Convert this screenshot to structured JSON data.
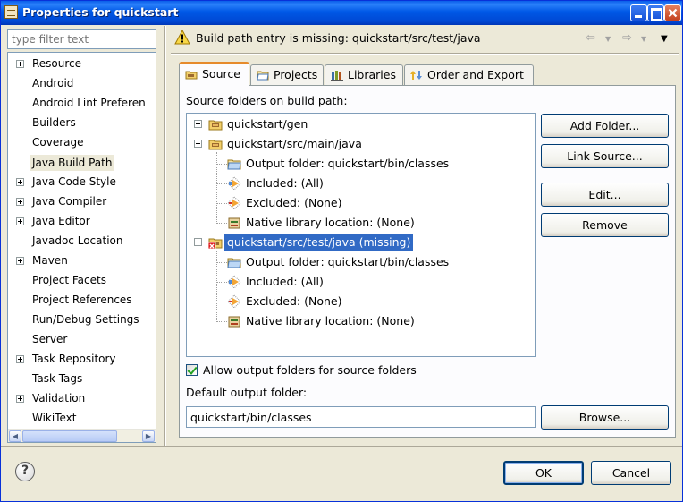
{
  "window": {
    "title": "Properties for quickstart"
  },
  "filter": {
    "placeholder": "type filter text"
  },
  "nav": {
    "items": [
      {
        "label": "Resource",
        "expandable": true
      },
      {
        "label": "Android",
        "expandable": false
      },
      {
        "label": "Android Lint Preferen",
        "expandable": false
      },
      {
        "label": "Builders",
        "expandable": false
      },
      {
        "label": "Coverage",
        "expandable": false
      },
      {
        "label": "Java Build Path",
        "expandable": false,
        "selected": true
      },
      {
        "label": "Java Code Style",
        "expandable": true
      },
      {
        "label": "Java Compiler",
        "expandable": true
      },
      {
        "label": "Java Editor",
        "expandable": true
      },
      {
        "label": "Javadoc Location",
        "expandable": false
      },
      {
        "label": "Maven",
        "expandable": true
      },
      {
        "label": "Project Facets",
        "expandable": false
      },
      {
        "label": "Project References",
        "expandable": false
      },
      {
        "label": "Run/Debug Settings",
        "expandable": false
      },
      {
        "label": "Server",
        "expandable": false
      },
      {
        "label": "Task Repository",
        "expandable": true
      },
      {
        "label": "Task Tags",
        "expandable": false
      },
      {
        "label": "Validation",
        "expandable": true
      },
      {
        "label": "WikiText",
        "expandable": false
      }
    ]
  },
  "header": {
    "message": "Build path entry is missing: quickstart/src/test/java"
  },
  "tabs": [
    {
      "label": "Source",
      "icon": "source-folder-icon"
    },
    {
      "label": "Projects",
      "icon": "projects-icon"
    },
    {
      "label": "Libraries",
      "icon": "libraries-icon"
    },
    {
      "label": "Order and Export",
      "icon": "order-export-icon"
    }
  ],
  "source": {
    "folders_label": "Source folders on build path:",
    "tree": [
      {
        "label": "quickstart/gen",
        "level": 0,
        "expander": "plus",
        "icon": "package-folder-icon"
      },
      {
        "label": "quickstart/src/main/java",
        "level": 0,
        "expander": "minus",
        "icon": "package-folder-icon"
      },
      {
        "label": "Output folder: quickstart/bin/classes",
        "level": 1,
        "icon": "output-folder-icon"
      },
      {
        "label": "Included: (All)",
        "level": 1,
        "icon": "included-icon"
      },
      {
        "label": "Excluded: (None)",
        "level": 1,
        "icon": "excluded-icon"
      },
      {
        "label": "Native library location: (None)",
        "level": 1,
        "icon": "native-library-icon"
      },
      {
        "label": "quickstart/src/test/java (missing)",
        "level": 0,
        "expander": "minus",
        "icon": "missing-folder-icon",
        "selected": true
      },
      {
        "label": "Output folder: quickstart/bin/classes",
        "level": 1,
        "icon": "output-folder-icon"
      },
      {
        "label": "Included: (All)",
        "level": 1,
        "icon": "included-icon"
      },
      {
        "label": "Excluded: (None)",
        "level": 1,
        "icon": "excluded-icon"
      },
      {
        "label": "Native library location: (None)",
        "level": 1,
        "icon": "native-library-icon"
      }
    ],
    "buttons": {
      "add_folder": "Add Folder...",
      "link_source": "Link Source...",
      "edit": "Edit...",
      "remove": "Remove"
    },
    "allow_output_label": "Allow output folders for source folders",
    "allow_output_checked": true,
    "default_output_label": "Default output folder:",
    "default_output_value": "quickstart/bin/classes",
    "browse": "Browse..."
  },
  "footer": {
    "ok": "OK",
    "cancel": "Cancel"
  },
  "colors": {
    "selection": "#316ac5",
    "tab_accent": "#e68b2c",
    "titlebar": "#0058e6"
  }
}
